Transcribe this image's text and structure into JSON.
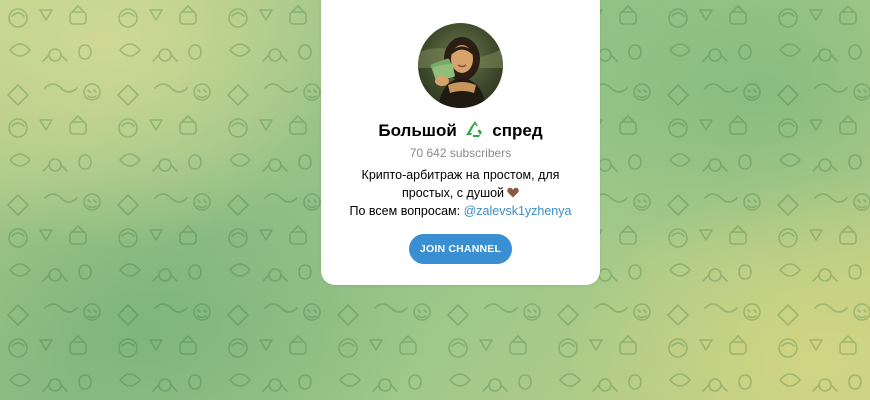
{
  "channel": {
    "name_part1": "Большой",
    "name_emoji": "recycle-icon",
    "name_part2": "спред",
    "subscribers": "70 642 subscribers",
    "description_line1": "Крипто-арбитраж на простом, для простых, с душой",
    "description_emoji": "brown-heart-icon",
    "description_line2_prefix": "По всем вопросам:",
    "description_link": "@zalevsk1yzhenya",
    "join_label": "JOIN CHANNEL"
  },
  "colors": {
    "accent": "#3a8ed2",
    "link": "#3a8ec9",
    "muted": "#8a8a8a",
    "card": "#ffffff"
  }
}
